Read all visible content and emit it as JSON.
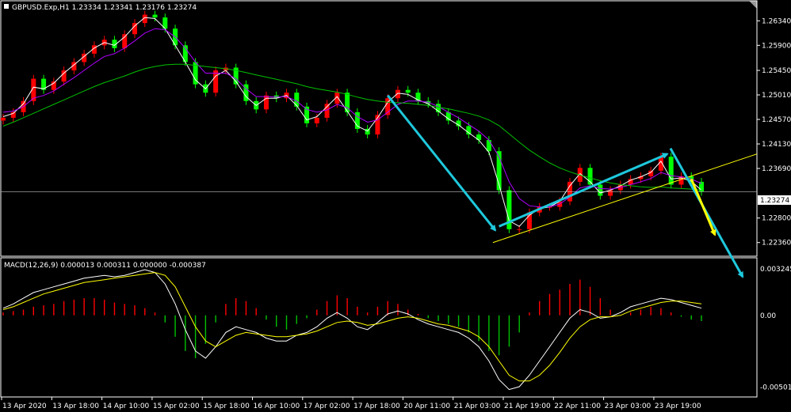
{
  "header": {
    "symbol_line": "GBPUSD.Exp,H1  1.23334 1.23341 1.23176 1.23274"
  },
  "macd_header": "MACD(12,26,9) 0.000013 0.000311 0.000000 -0.000387",
  "current_price_label": "1.23274",
  "colors": {
    "background": "#000000",
    "bull_candle": "#ff0000",
    "bear_candle": "#00ff00",
    "ma_fast": "#ffffff",
    "ma_mid": "#ffff00",
    "ma_slow": "#b000ff",
    "ma_long": "#00c000",
    "arrow_cyan": "#1ec8dc",
    "arrow_yellow": "#ffff00",
    "trendline": "#ffff00",
    "macd_pos": "#ff0000",
    "macd_neg": "#00c000",
    "macd_line": "#ffffff",
    "signal_line": "#ffff00"
  },
  "chart_data": [
    {
      "type": "line",
      "panel": "price",
      "y_ticks": [
        "1.26340",
        "1.25900",
        "1.25450",
        "1.25010",
        "1.24570",
        "1.24130",
        "1.23690",
        "1.23274",
        "1.22800",
        "1.22360"
      ],
      "ylim": [
        1.222,
        1.266
      ],
      "x_ticks": [
        "13 Apr 2020",
        "13 Apr 18:00",
        "14 Apr 10:00",
        "15 Apr 02:00",
        "15 Apr 18:00",
        "16 Apr 10:00",
        "17 Apr 02:00",
        "17 Apr 18:00",
        "20 Apr 11:00",
        "21 Apr 03:00",
        "21 Apr 19:00",
        "22 Apr 11:00",
        "23 Apr 03:00",
        "23 Apr 19:00"
      ],
      "series": [
        {
          "name": "close",
          "values": [
            1.246,
            1.247,
            1.249,
            1.253,
            1.251,
            1.2525,
            1.2545,
            1.256,
            1.2575,
            1.259,
            1.26,
            1.2585,
            1.261,
            1.263,
            1.2645,
            1.264,
            1.262,
            1.259,
            1.256,
            1.252,
            1.2505,
            1.2545,
            1.255,
            1.252,
            1.249,
            1.2475,
            1.25,
            1.2495,
            1.2505,
            1.248,
            1.245,
            1.246,
            1.2485,
            1.2505,
            1.247,
            1.244,
            1.243,
            1.2465,
            1.2495,
            1.251,
            1.2505,
            1.249,
            1.2485,
            1.247,
            1.2455,
            1.2445,
            1.243,
            1.242,
            1.24,
            1.233,
            1.226,
            1.226,
            1.229,
            1.23,
            1.23,
            1.231,
            1.2345,
            1.237,
            1.234,
            1.232,
            1.233,
            1.234,
            1.235,
            1.2355,
            1.2365,
            1.239,
            1.234,
            1.2355,
            1.2345,
            1.2327
          ]
        }
      ],
      "ma_series": [
        {
          "name": "ma_fast",
          "values": [
            1.2462,
            1.2468,
            1.2485,
            1.2515,
            1.2512,
            1.2522,
            1.254,
            1.2555,
            1.257,
            1.2585,
            1.2595,
            1.259,
            1.2605,
            1.2625,
            1.264,
            1.2638,
            1.262,
            1.259,
            1.256,
            1.2528,
            1.2512,
            1.2535,
            1.2545,
            1.2525,
            1.2498,
            1.2482,
            1.2495,
            1.2495,
            1.25,
            1.2482,
            1.2456,
            1.2462,
            1.248,
            1.2498,
            1.2472,
            1.2445,
            1.2436,
            1.246,
            1.2488,
            1.2504,
            1.2502,
            1.2492,
            1.2485,
            1.2472,
            1.2458,
            1.2447,
            1.2433,
            1.242,
            1.2398,
            1.234,
            1.2275,
            1.2265,
            1.2285,
            1.2297,
            1.23,
            1.231,
            1.2338,
            1.236,
            1.2345,
            1.2325,
            1.233,
            1.2338,
            1.2348,
            1.2354,
            1.2362,
            1.2382,
            1.235,
            1.2352,
            1.2346,
            1.233
          ]
        },
        {
          "name": "ma_slow",
          "values": [
            1.247,
            1.2472,
            1.248,
            1.2495,
            1.25,
            1.2508,
            1.252,
            1.2532,
            1.2545,
            1.2558,
            1.257,
            1.2575,
            1.2585,
            1.2598,
            1.2612,
            1.262,
            1.2618,
            1.2605,
            1.2585,
            1.256,
            1.254,
            1.254,
            1.254,
            1.253,
            1.2512,
            1.2498,
            1.2498,
            1.2497,
            1.2498,
            1.249,
            1.2475,
            1.247,
            1.2474,
            1.2484,
            1.2478,
            1.2462,
            1.2452,
            1.2456,
            1.247,
            1.2484,
            1.249,
            1.249,
            1.2488,
            1.248,
            1.247,
            1.246,
            1.2448,
            1.2436,
            1.242,
            1.239,
            1.2345,
            1.2315,
            1.2302,
            1.23,
            1.23,
            1.2305,
            1.2318,
            1.2334,
            1.2338,
            1.2333,
            1.2332,
            1.2335,
            1.234,
            1.2345,
            1.2351,
            1.2362,
            1.2356,
            1.2354,
            1.235,
            1.2342
          ]
        },
        {
          "name": "ma_long",
          "values": [
            1.2445,
            1.2452,
            1.246,
            1.2468,
            1.2476,
            1.2484,
            1.2492,
            1.25,
            1.2508,
            1.2516,
            1.2523,
            1.2529,
            1.2535,
            1.2542,
            1.2548,
            1.2552,
            1.2555,
            1.2556,
            1.2556,
            1.2554,
            1.2552,
            1.255,
            1.2548,
            1.2545,
            1.2541,
            1.2537,
            1.2533,
            1.2529,
            1.2525,
            1.2521,
            1.2516,
            1.2512,
            1.2509,
            1.2506,
            1.2502,
            1.2497,
            1.2493,
            1.249,
            1.2488,
            1.2487,
            1.2486,
            1.2484,
            1.2482,
            1.2479,
            1.2476,
            1.2472,
            1.2468,
            1.2463,
            1.2456,
            1.2446,
            1.2431,
            1.2416,
            1.2402,
            1.239,
            1.2379,
            1.237,
            1.2363,
            1.2357,
            1.2352,
            1.2347,
            1.2343,
            1.234,
            1.2338,
            1.2336,
            1.2335,
            1.2336,
            1.2334,
            1.2333,
            1.2332,
            1.233
          ]
        }
      ]
    },
    {
      "type": "bar",
      "panel": "macd",
      "y_ticks": [
        "0.003245",
        "0.00",
        "-0.005018"
      ],
      "ylim": [
        -0.0055,
        0.0037
      ],
      "series": [
        {
          "name": "histogram",
          "values": [
            0.0002,
            0.0003,
            0.0004,
            0.0006,
            0.0007,
            0.0008,
            0.001,
            0.0011,
            0.0012,
            0.0012,
            0.0011,
            0.0009,
            0.0008,
            0.0007,
            0.0005,
            0.0002,
            -0.0005,
            -0.0015,
            -0.0025,
            -0.003,
            -0.002,
            -0.0005,
            0.0008,
            0.0012,
            0.001,
            0.0005,
            -0.0003,
            -0.0008,
            -0.001,
            -0.0006,
            -0.0002,
            0.0004,
            0.001,
            0.0014,
            0.0012,
            0.0006,
            0.0002,
            0.0006,
            0.001,
            0.0008,
            0.0004,
            0.0001,
            -0.0002,
            -0.0004,
            -0.0006,
            -0.0008,
            -0.0012,
            -0.0018,
            -0.0025,
            -0.0028,
            -0.0022,
            -0.0012,
            0.0002,
            0.001,
            0.0015,
            0.0018,
            0.0022,
            0.0025,
            0.002,
            0.0012,
            0.0004,
            0.0,
            0.0002,
            0.0004,
            0.0006,
            0.0005,
            0.0002,
            -0.0001,
            -0.0003,
            -0.0004
          ]
        },
        {
          "name": "macd",
          "values": [
            0.0005,
            0.0008,
            0.0012,
            0.0016,
            0.0018,
            0.002,
            0.0022,
            0.0024,
            0.0026,
            0.0027,
            0.0028,
            0.0027,
            0.0028,
            0.003,
            0.0032,
            0.003,
            0.0022,
            0.0008,
            -0.001,
            -0.0025,
            -0.003,
            -0.0022,
            -0.0012,
            -0.0008,
            -0.001,
            -0.0012,
            -0.0016,
            -0.0018,
            -0.0018,
            -0.0014,
            -0.0012,
            -0.0008,
            -0.0002,
            0.0002,
            -0.0002,
            -0.0008,
            -0.001,
            -0.0005,
            0.0001,
            0.0003,
            0.0001,
            -0.0003,
            -0.0006,
            -0.0008,
            -0.001,
            -0.0012,
            -0.0016,
            -0.0022,
            -0.0032,
            -0.0045,
            -0.0052,
            -0.005,
            -0.0042,
            -0.0032,
            -0.0022,
            -0.0012,
            -0.0002,
            0.0004,
            0.0002,
            -0.0002,
            -0.0001,
            0.0002,
            0.0006,
            0.0008,
            0.001,
            0.0012,
            0.0011,
            0.0009,
            0.0007,
            0.0005
          ]
        },
        {
          "name": "signal",
          "values": [
            0.0004,
            0.0006,
            0.0009,
            0.0012,
            0.0015,
            0.0017,
            0.0019,
            0.0021,
            0.0023,
            0.0024,
            0.0025,
            0.0026,
            0.0027,
            0.0028,
            0.0029,
            0.003,
            0.0028,
            0.002,
            0.0006,
            -0.0008,
            -0.0018,
            -0.0022,
            -0.0018,
            -0.0014,
            -0.0012,
            -0.0013,
            -0.0014,
            -0.0015,
            -0.0015,
            -0.0014,
            -0.0013,
            -0.0011,
            -0.0008,
            -0.0005,
            -0.0004,
            -0.0005,
            -0.0007,
            -0.0006,
            -0.0004,
            -0.0002,
            -0.0001,
            -0.0002,
            -0.0004,
            -0.0006,
            -0.0007,
            -0.0009,
            -0.0011,
            -0.0015,
            -0.0022,
            -0.0032,
            -0.0042,
            -0.0046,
            -0.0046,
            -0.0042,
            -0.0035,
            -0.0026,
            -0.0016,
            -0.0008,
            -0.0003,
            -0.0001,
            -0.0001,
            0.0,
            0.0003,
            0.0005,
            0.0007,
            0.0009,
            0.001,
            0.001,
            0.0009,
            0.0008
          ]
        }
      ]
    }
  ],
  "annotations": {
    "trend_arrows_count": 4,
    "trendline": "rising support"
  }
}
